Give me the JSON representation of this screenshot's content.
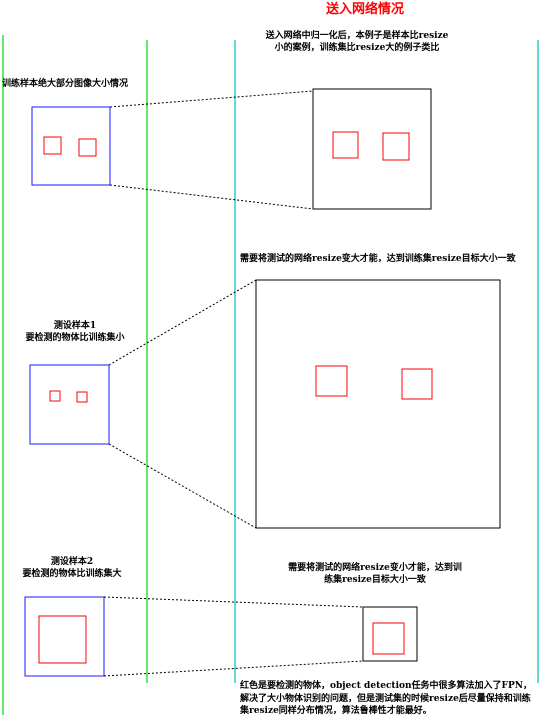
{
  "title": "送入网络情况",
  "colors": {
    "green_divider": "#33dd33",
    "cyan_divider": "#33cccc",
    "sample_box": "#1a1aff",
    "object_box": "#ff0000",
    "network_box": "#000000",
    "title_color": "#ff0000"
  },
  "sections": {
    "train": {
      "left_label": "训练样本绝大部分图像大小情况",
      "right_note": "送入网络中归一化后，本例子是样本比resize小的案例，训练集比resize大的例子类比"
    },
    "test1": {
      "left_label": "测设样本1\n要检测的物体比训练集小",
      "right_note": "需要将测试的网络resize变大才能，达到训练集resize目标大小一致"
    },
    "test2": {
      "left_label": "测设样本2\n要检测的物体比训练集大",
      "right_note": "需要将测试的网络resize变小才能，达到训练集resize目标大小一致"
    }
  },
  "footer_note": "红色是要检测的物体，object detection任务中很多算法加入了FPN，解决了大小物体识别的问题，但是测试集的时候resize后尽量保持和训练集resize同样分布情况，算法鲁棒性才能最好。"
}
